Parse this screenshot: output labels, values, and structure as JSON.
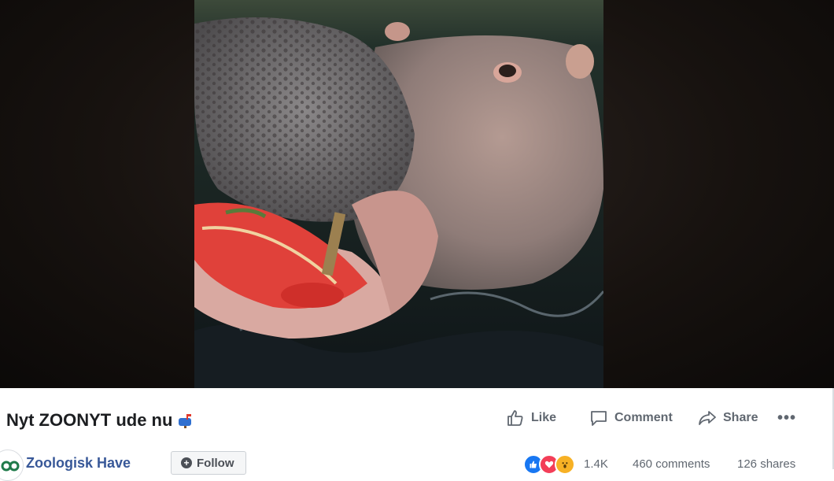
{
  "post": {
    "title": "Nyt ZOONYT ude nu",
    "page_name": "Zoologisk Have",
    "follow_label": "Follow"
  },
  "actions": {
    "like_label": "Like",
    "comment_label": "Comment",
    "share_label": "Share",
    "more_label": "•••"
  },
  "stats": {
    "reactions_count": "1.4K",
    "comments_count": "460 comments",
    "shares_count": "126 shares"
  },
  "icons": {
    "like": "thumbs-up-icon",
    "comment": "comment-bubble-icon",
    "share": "share-arrow-icon",
    "title_emoji": "mailbox-icon",
    "reactions": [
      "like-reaction-icon",
      "love-reaction-icon",
      "wow-reaction-icon"
    ]
  },
  "colors": {
    "link_blue": "#385898",
    "action_gray": "#606770",
    "like_blue": "#1877f2",
    "love_red": "#f33e58",
    "wow_yellow": "#f7b125"
  }
}
